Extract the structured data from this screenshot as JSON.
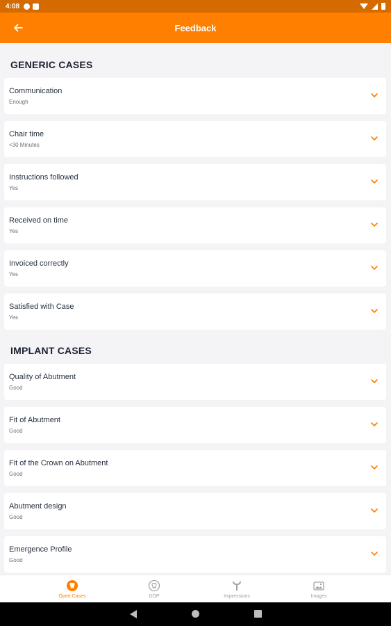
{
  "status_bar": {
    "time": "4:08"
  },
  "app_bar": {
    "title": "Feedback"
  },
  "sections": {
    "generic": {
      "title": "GENERIC CASES"
    },
    "implant": {
      "title": "IMPLANT CASES"
    }
  },
  "generic_items": [
    {
      "label": "Communication",
      "value": "Enough"
    },
    {
      "label": "Chair time",
      "value": "<30 Minutes"
    },
    {
      "label": "Instructions followed",
      "value": "Yes"
    },
    {
      "label": "Received on time",
      "value": "Yes"
    },
    {
      "label": "Invoiced correctly",
      "value": "Yes"
    },
    {
      "label": "Satisfied with Case",
      "value": "Yes"
    }
  ],
  "implant_items": [
    {
      "label": "Quality of Abutment",
      "value": "Good"
    },
    {
      "label": "Fit of Abutment",
      "value": "Good"
    },
    {
      "label": "Fit of the Crown on Abutment",
      "value": "Good"
    },
    {
      "label": "Abutment design",
      "value": "Good"
    },
    {
      "label": "Emergence Profile",
      "value": "Good"
    }
  ],
  "bottom_nav": [
    {
      "label": "Open Cases",
      "icon": "tooth-icon"
    },
    {
      "label": "DOP",
      "icon": "tooth-circle-icon"
    },
    {
      "label": "Impressions",
      "icon": "impression-icon"
    },
    {
      "label": "Images",
      "icon": "images-icon"
    }
  ],
  "colors": {
    "accent": "#ff7f00",
    "status_bar": "#d46a00",
    "background": "#f4f4f6"
  }
}
